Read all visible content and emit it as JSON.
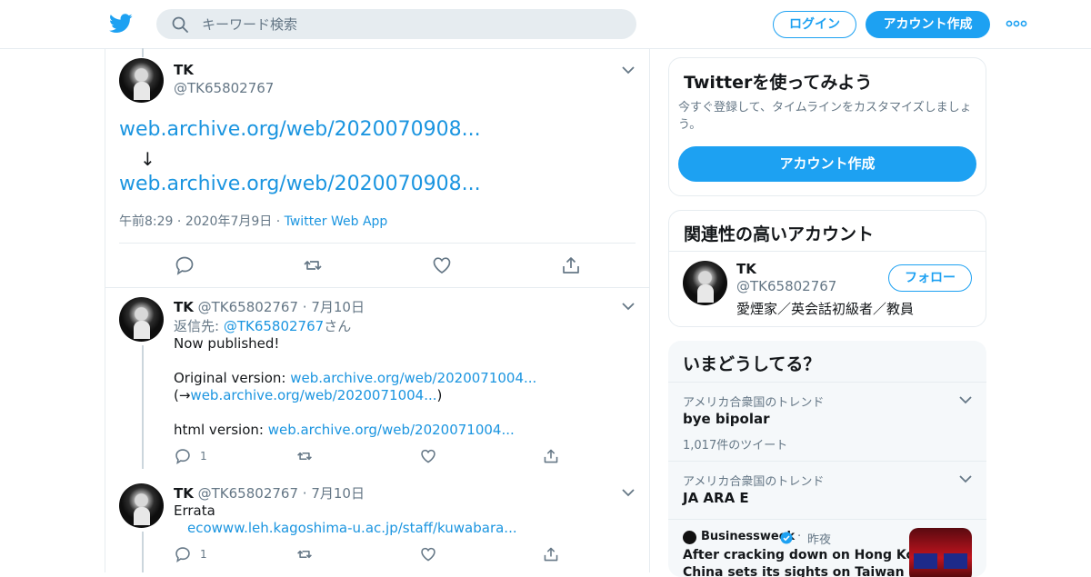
{
  "header": {
    "search_placeholder": "キーワード検索",
    "login": "ログイン",
    "signup": "アカウント作成"
  },
  "tweet1": {
    "name": "TK",
    "handle": "@TK65802767",
    "link1": "web.archive.org/web/2020070908...",
    "arrow": "↓",
    "link2": "web.archive.org/web/2020070908...",
    "time": "午前8:29",
    "dot": "·",
    "date": "2020年7月9日",
    "source": "Twitter Web App"
  },
  "tweet2": {
    "name": "TK",
    "handle": "@TK65802767",
    "dot": "·",
    "date": "7月10日",
    "reply_prefix": "返信先: ",
    "reply_handle": "@TK65802767",
    "reply_suffix": "さん",
    "line1": "Now published!",
    "orig_label": "Original version: ",
    "orig_link": "web.archive.org/web/2020071004...",
    "paren_open": "(→",
    "paren_link": "web.archive.org/web/2020071004...",
    "paren_close": ")",
    "html_label": "html version: ",
    "html_link": "web.archive.org/web/2020071004...",
    "reply_count": "1"
  },
  "tweet3": {
    "name": "TK",
    "handle": "@TK65802767",
    "dot": "·",
    "date": "7月10日",
    "line1": "Errata",
    "link": "ecowww.leh.kagoshima-u.ac.jp/staff/kuwabara...",
    "reply_count": "1"
  },
  "sidebar": {
    "try_title": "Twitterを使ってみよう",
    "try_desc": "今すぐ登録して、タイムラインをカスタマイズしましょう。",
    "try_button": "アカウント作成",
    "related_title": "関連性の高いアカウント",
    "related_name": "TK",
    "related_handle": "@TK65802767",
    "related_bio": "愛煙家／英会話初級者／教員",
    "follow": "フォロー",
    "trends_title": "いまどうしてる？",
    "trends": [
      {
        "context": "アメリカ合衆国のトレンド",
        "name": "bye bipolar",
        "count": "1,017件のツイート"
      },
      {
        "context": "アメリカ合衆国のトレンド",
        "name": "JA ARA E"
      }
    ],
    "news": {
      "source": "Businessweek",
      "dot": "·",
      "time": "昨夜",
      "headline_line1": "After cracking down on Hong Kong,",
      "headline_line2": "China sets its sights on Taiwan"
    }
  },
  "colors": {
    "accent": "#1da1f2",
    "link": "#1b95e0",
    "muted": "#657786",
    "border": "#e6ecf0"
  }
}
